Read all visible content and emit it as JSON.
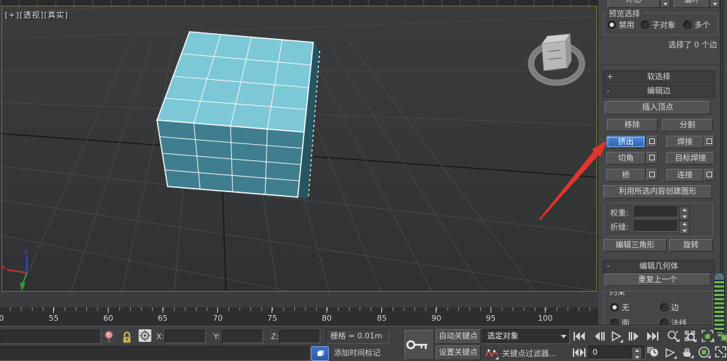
{
  "colors": {
    "accent_blue": "#2d64bd",
    "cube_top": "#7cc8d6",
    "cube_front": "#3f7e8e",
    "cube_side": "#245560",
    "arrow_red": "#e2362c",
    "viewport_border": "#7d6f35",
    "green_icon": "#7cb85c"
  },
  "viewport": {
    "label": "[+][透视][真实]"
  },
  "panel": {
    "ring_button": "环形",
    "loop_button": "循环",
    "preview_selection": {
      "title": "预览选择",
      "disable": "禁用",
      "subobj": "子对象",
      "multiple": "多个"
    },
    "selection_status": "选择了 0 个边",
    "soft_selection": {
      "toggle": "+",
      "title": "软选择"
    },
    "edit_edges": {
      "toggle": "-",
      "title": "编辑边",
      "insert_vertex": "插入顶点",
      "remove": "移除",
      "split": "分割",
      "extrude": "挤出",
      "weld": "焊接",
      "chamfer": "切角",
      "target_weld": "目标焊接",
      "bridge": "桥",
      "connect": "连接",
      "create_shape": "利用所选内容创建图形",
      "weight": "权重:",
      "crease": "折缝:",
      "edit_triangulation": "编辑三角形",
      "turn": "旋转"
    },
    "edit_geometry": {
      "toggle": "-",
      "title": "编辑几何体",
      "repeat_last": "重复上一个",
      "constraints": "约束",
      "none": "无",
      "edge": "边",
      "face": "面",
      "normal": "法线"
    }
  },
  "timeline": {
    "edge_label": "0",
    "labels": [
      "55",
      "60",
      "65",
      "70",
      "75",
      "80",
      "85",
      "90",
      "95",
      "100"
    ]
  },
  "status": {
    "x": "X:",
    "y": "Y:",
    "z": "Z:",
    "grid": "栅格 = 0.01m",
    "add_time_tag": "添加时间标记",
    "auto_key": "自动关键点",
    "set_key": "设置关键点",
    "selection_set": "选定对象",
    "key_filters": "关键点过滤器...",
    "frame": "0"
  }
}
